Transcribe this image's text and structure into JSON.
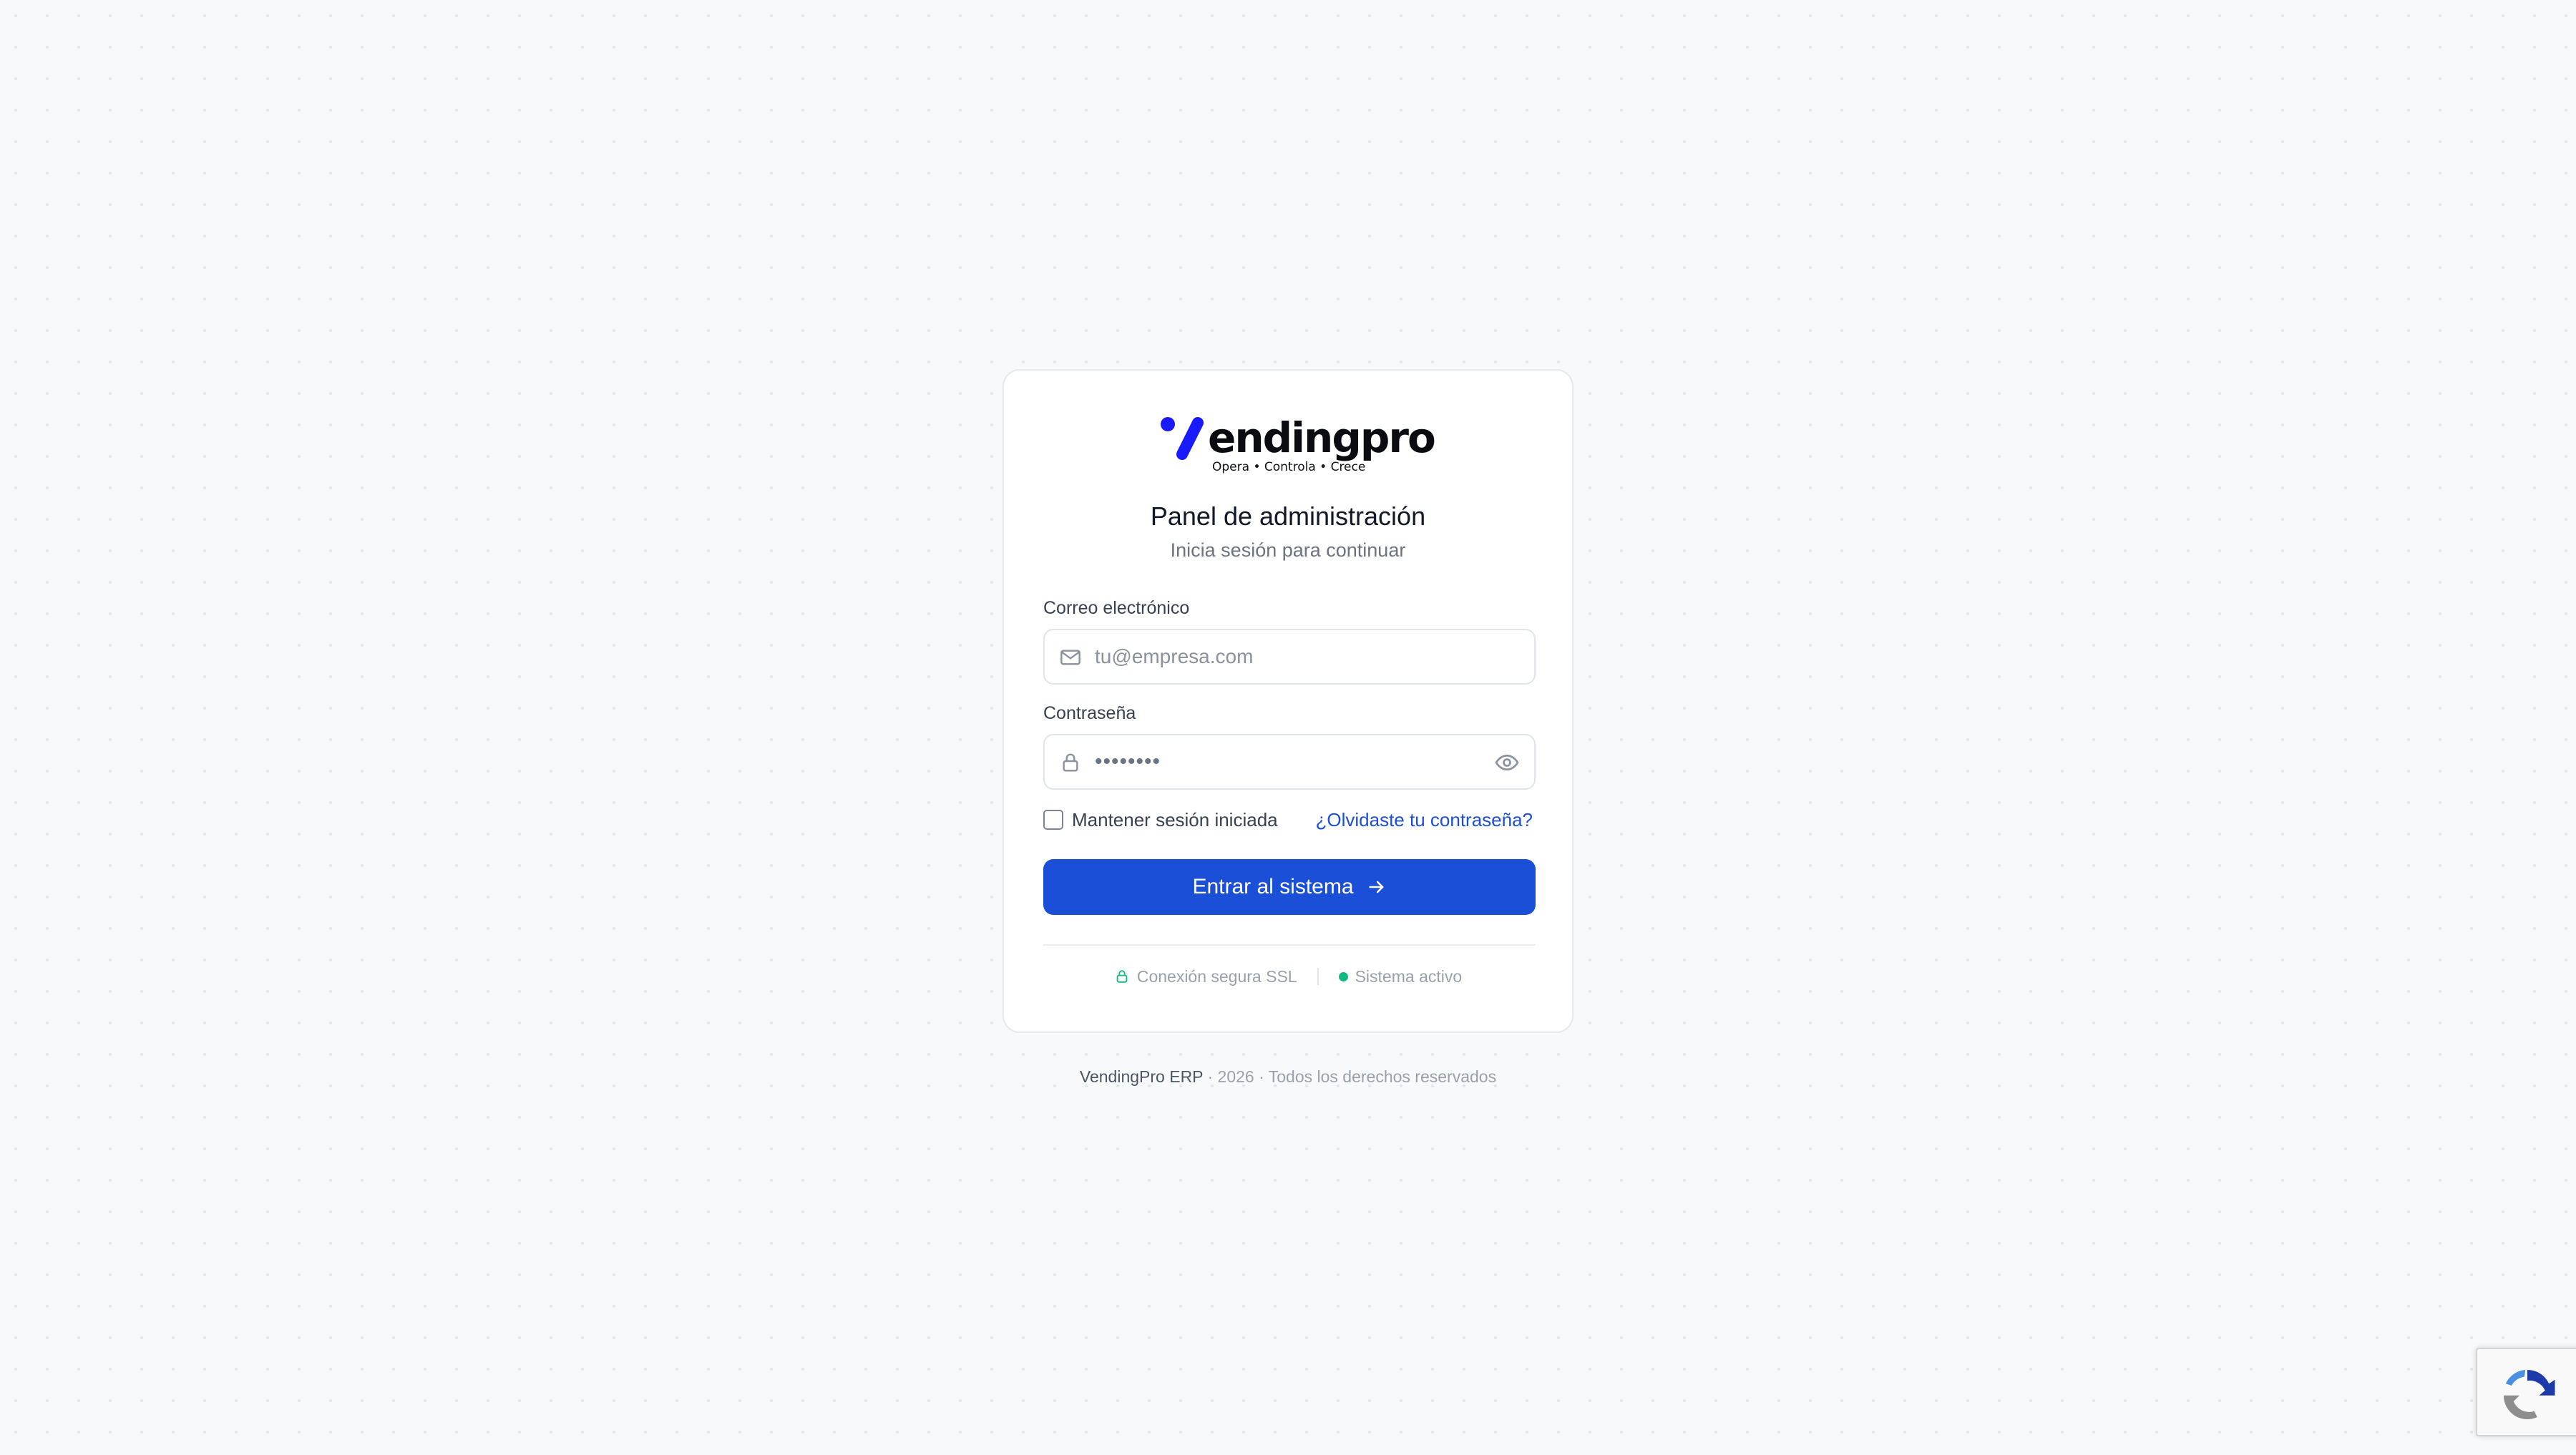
{
  "brand": {
    "logo_text": "endingpro",
    "tagline": "Opera • Controla • Crece",
    "logo_colors": {
      "mark": "#1a1aff",
      "text": "#0b0b12"
    }
  },
  "header": {
    "title": "Panel de administración",
    "subtitle": "Inicia sesión para continuar"
  },
  "form": {
    "email": {
      "label": "Correo electrónico",
      "placeholder": "tu@empresa.com",
      "value": "",
      "icon": "mail-icon"
    },
    "password": {
      "label": "Contraseña",
      "masked_value": "••••••••",
      "icon": "lock-icon",
      "toggle_icon": "eye-icon"
    },
    "remember": {
      "label": "Mantener sesión iniciada",
      "checked": false
    },
    "forgot_link": "¿Olvidaste tu contraseña?",
    "submit_label": "Entrar al sistema",
    "submit_icon": "arrow-right-icon"
  },
  "status": {
    "secure": "Conexión segura SSL",
    "system": "Sistema activo",
    "system_color": "#10b981"
  },
  "footer": {
    "brand": "VendingPro ERP",
    "rest": "· 2026 · Todos los derechos reservados"
  },
  "colors": {
    "primary": "#1b4fd8",
    "link": "#1d4ed8",
    "background": "#f8f9fb"
  }
}
